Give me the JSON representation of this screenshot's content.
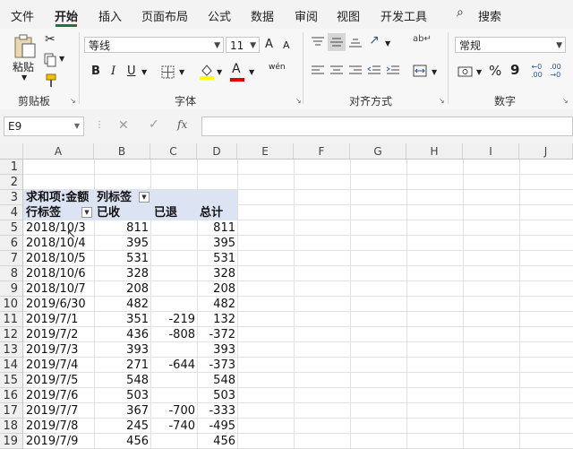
{
  "ribbon_tabs": [
    "文件",
    "开始",
    "插入",
    "页面布局",
    "公式",
    "数据",
    "审阅",
    "视图",
    "开发工具"
  ],
  "active_tab": "开始",
  "search_label": "搜索",
  "groups": {
    "clipboard": {
      "label": "剪贴板",
      "paste_label": "粘贴"
    },
    "font": {
      "label": "字体",
      "font_name": "等线",
      "font_size": "11",
      "bold": "B",
      "italic": "I",
      "underline": "U",
      "grow": "A",
      "shrink": "A",
      "phonetic": "wén",
      "font_color_letter": "A"
    },
    "alignment": {
      "label": "对齐方式"
    },
    "number": {
      "label": "数字",
      "format": "常规",
      "percent": "%",
      "comma": "9"
    }
  },
  "formula_bar": {
    "name_box": "E9",
    "fx": "fx",
    "value": ""
  },
  "columns": [
    "A",
    "B",
    "C",
    "D",
    "E",
    "F",
    "G",
    "H",
    "I",
    "J"
  ],
  "rows": [
    "1",
    "2",
    "3",
    "4",
    "5",
    "6",
    "7",
    "8",
    "9",
    "10",
    "11",
    "12",
    "13",
    "14",
    "15",
    "16",
    "17",
    "18",
    "19"
  ],
  "pivot": {
    "values_header": "求和项:金额",
    "column_labels": "列标签",
    "row_labels": "行标签",
    "col_headers": [
      "已收",
      "已退",
      "总计"
    ],
    "data": [
      {
        "label": "2018/10/3",
        "received": "811",
        "returned": "",
        "total": "811"
      },
      {
        "label": "2018/10/4",
        "received": "395",
        "returned": "",
        "total": "395"
      },
      {
        "label": "2018/10/5",
        "received": "531",
        "returned": "",
        "total": "531"
      },
      {
        "label": "2018/10/6",
        "received": "328",
        "returned": "",
        "total": "328"
      },
      {
        "label": "2018/10/7",
        "received": "208",
        "returned": "",
        "total": "208"
      },
      {
        "label": "2019/6/30",
        "received": "482",
        "returned": "",
        "total": "482"
      },
      {
        "label": "2019/7/1",
        "received": "351",
        "returned": "-219",
        "total": "132"
      },
      {
        "label": "2019/7/2",
        "received": "436",
        "returned": "-808",
        "total": "-372"
      },
      {
        "label": "2019/7/3",
        "received": "393",
        "returned": "",
        "total": "393"
      },
      {
        "label": "2019/7/4",
        "received": "271",
        "returned": "-644",
        "total": "-373"
      },
      {
        "label": "2019/7/5",
        "received": "548",
        "returned": "",
        "total": "548"
      },
      {
        "label": "2019/7/6",
        "received": "503",
        "returned": "",
        "total": "503"
      },
      {
        "label": "2019/7/7",
        "received": "367",
        "returned": "-700",
        "total": "-333"
      },
      {
        "label": "2019/7/8",
        "received": "245",
        "returned": "-740",
        "total": "-495"
      },
      {
        "label": "2019/7/9",
        "received": "456",
        "returned": "",
        "total": "456"
      }
    ]
  },
  "colors": {
    "accent": "#217346",
    "pivot_header": "#dce3f3",
    "font_color": "#e00000",
    "fill_color": "#ffff00"
  }
}
